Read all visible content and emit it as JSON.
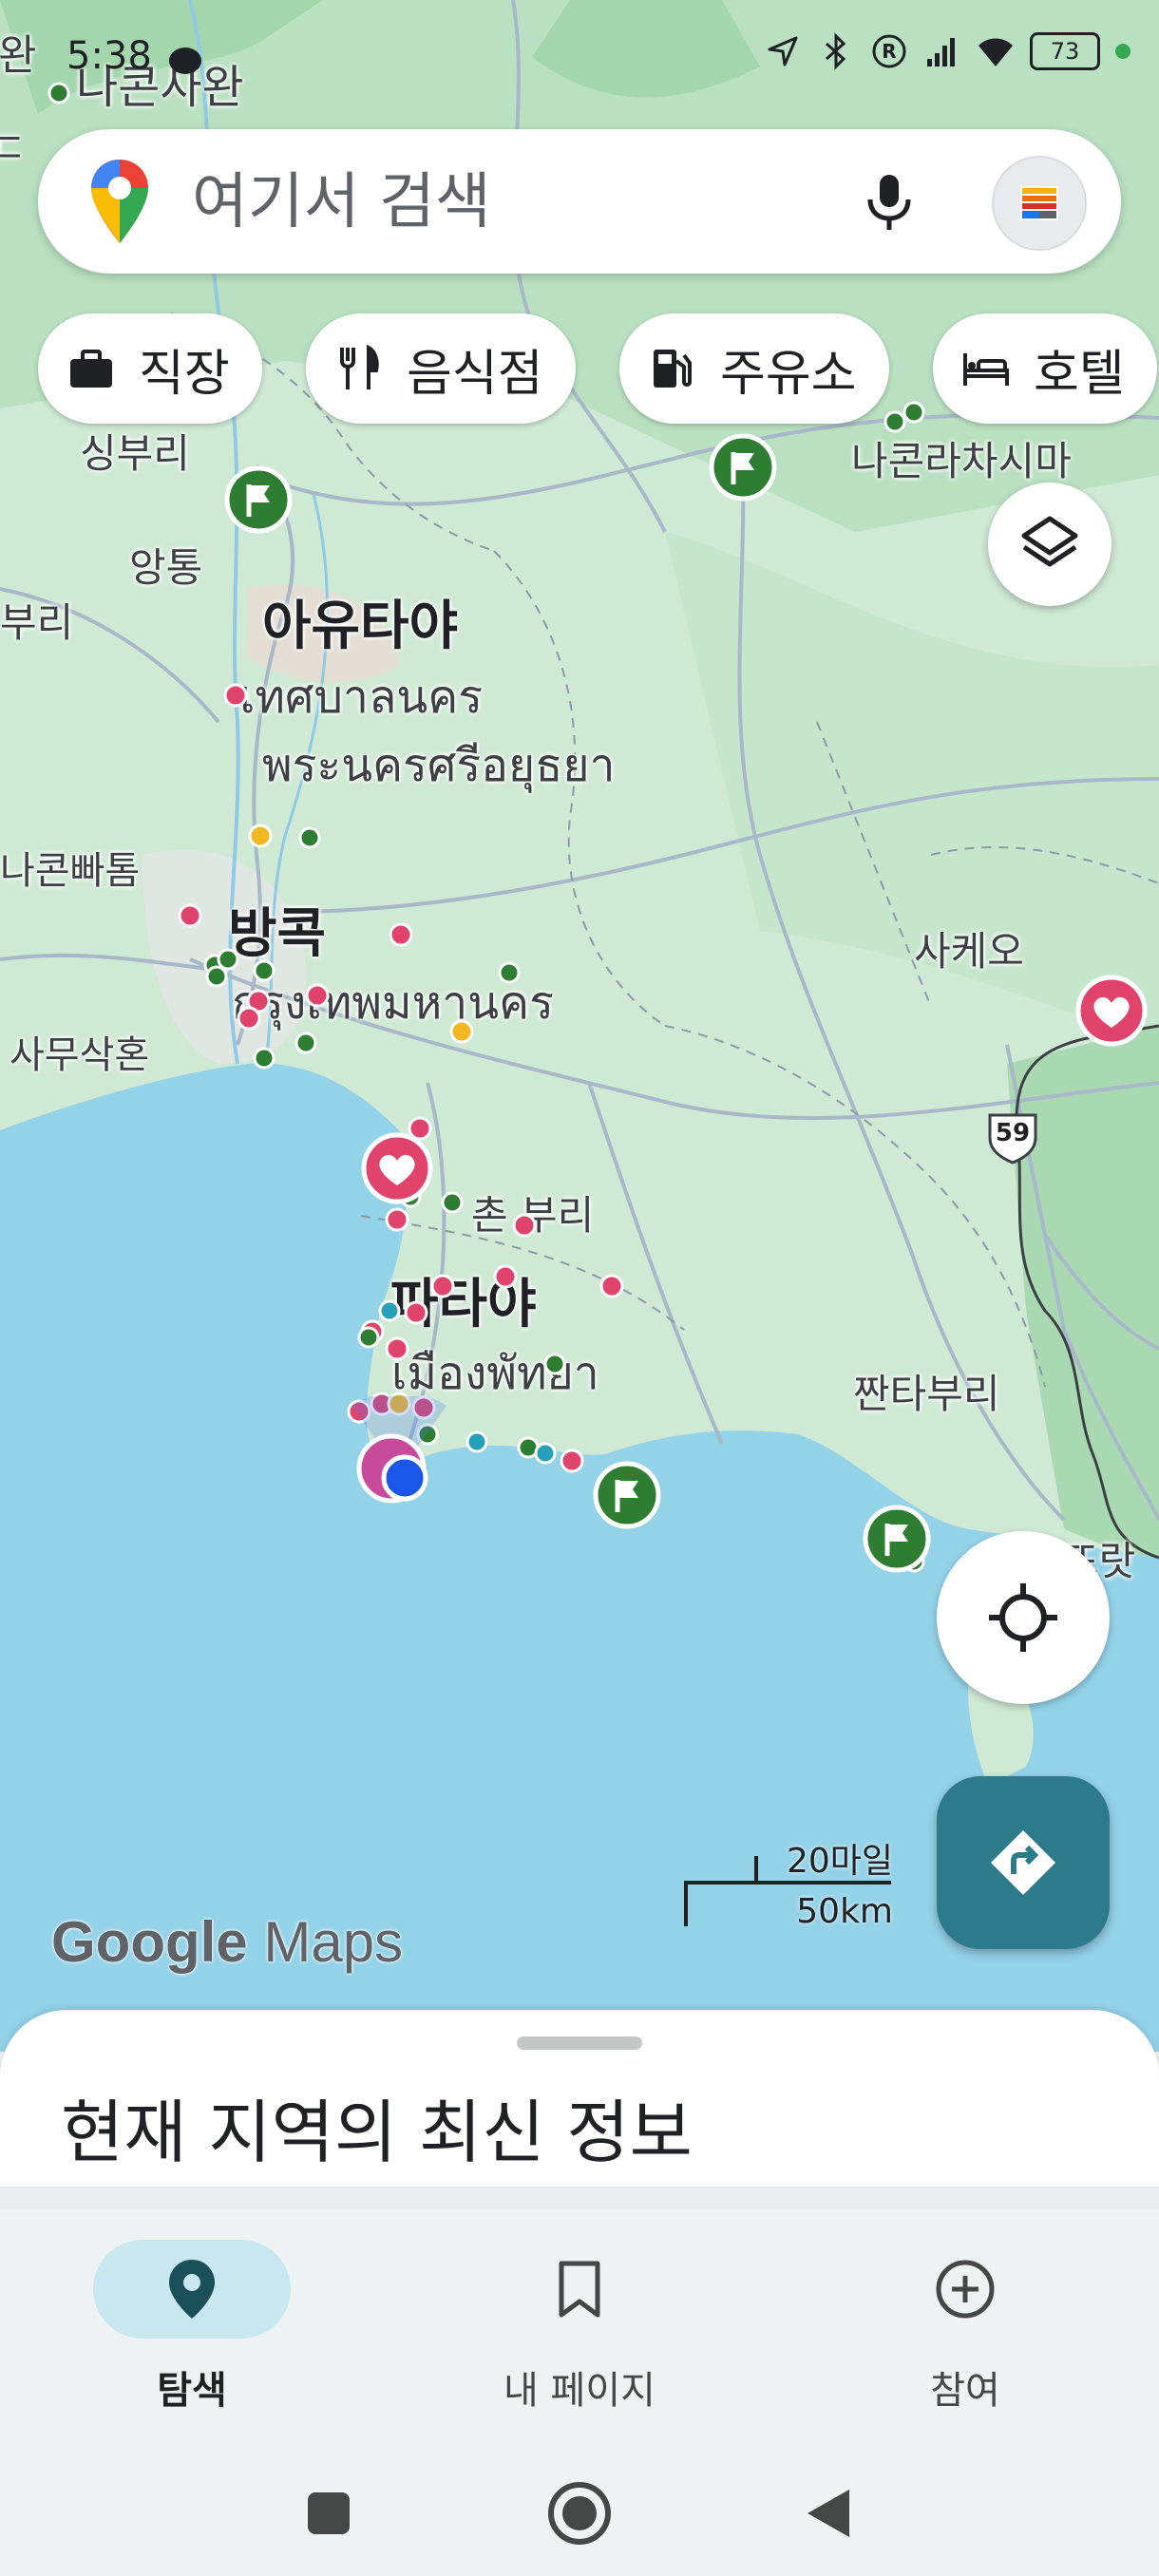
{
  "status_bar": {
    "time": "5:38",
    "battery": "73"
  },
  "search": {
    "placeholder": "여기서 검색"
  },
  "chips": [
    {
      "label": "직장",
      "icon": "briefcase-icon"
    },
    {
      "label": "음식점",
      "icon": "restaurant-icon"
    },
    {
      "label": "주유소",
      "icon": "gas-station-icon"
    },
    {
      "label": "호텔",
      "icon": "hotel-icon"
    }
  ],
  "map": {
    "labels": {
      "nakhon_sawan": "나콘사완",
      "singburi": "싱부리",
      "angthong": "앙통",
      "buri": "부리",
      "ayutthaya_ko": "아유타야",
      "thesaban_th": "เทศบาลนคร",
      "ayutthaya_th": "พระนครศรีอยุธยา",
      "nakhon_pathom": "나콘빠톰",
      "bangkok_ko": "방콕",
      "bangkok_th": "กรุงเทพมหานคร",
      "samut_sakhon": "사무삭혼",
      "chonburi": "촌 부리",
      "pattaya_ko": "파타야",
      "pattaya_th": "เมืองพัทยา",
      "nakhon_ratchasima": "나콘라차시마",
      "sa_kaeo": "사케오",
      "chanthaburi": "짠타부리",
      "trat": "뜨랏",
      "route_59": "59",
      "left_edge_1": "완",
      "left_edge_2": "ㄷ"
    },
    "scale": {
      "miles": "20마일",
      "km": "50km"
    },
    "logo_google": "Google",
    "logo_maps": "Maps",
    "colors": {
      "water": "#94d2e8",
      "land": "#cfe9d4",
      "pin_red": "#e0436b",
      "pin_green": "#2e7d32",
      "pin_yellow": "#f2b824",
      "pin_teal": "#26a1b7",
      "location_blue": "#1a57e8"
    }
  },
  "sheet": {
    "title": "현재 지역의 최신 정보"
  },
  "bottom_nav": [
    {
      "label": "탐색",
      "active": true
    },
    {
      "label": "내 페이지",
      "active": false
    },
    {
      "label": "참여",
      "active": false
    }
  ]
}
